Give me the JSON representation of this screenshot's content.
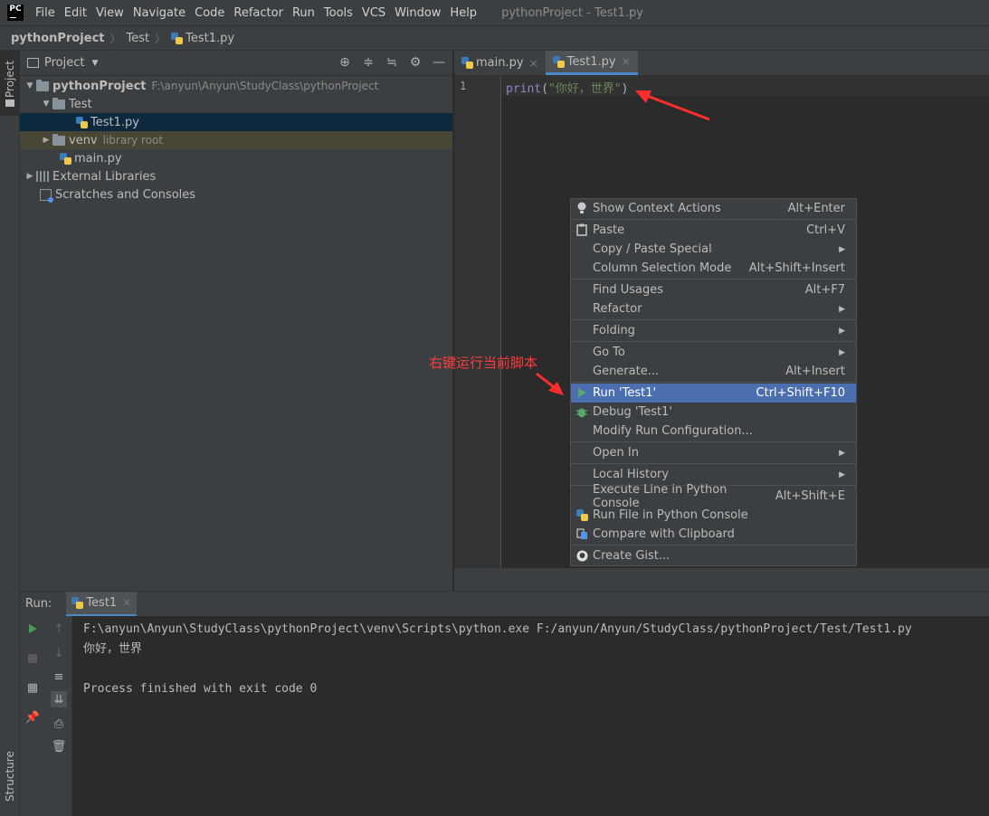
{
  "app": {
    "logo_text": "PC",
    "window_title": "pythonProject - Test1.py"
  },
  "menu": [
    "File",
    "Edit",
    "View",
    "Navigate",
    "Code",
    "Refactor",
    "Run",
    "Tools",
    "VCS",
    "Window",
    "Help"
  ],
  "breadcrumb": {
    "project": "pythonProject",
    "folder": "Test",
    "file": "Test1.py"
  },
  "left_strip": {
    "project_tab": "Project",
    "structure_tab": "Structure"
  },
  "project_panel": {
    "title": "Project",
    "tree": {
      "root_name": "pythonProject",
      "root_path": "F:\\anyun\\Anyun\\StudyClass\\pythonProject",
      "test_folder": "Test",
      "test_file": "Test1.py",
      "venv": "venv",
      "venv_note": "library root",
      "main_file": "main.py",
      "external_libs": "External Libraries",
      "scratches": "Scratches and Consoles"
    }
  },
  "editor": {
    "tabs": [
      {
        "label": "main.py",
        "active": false
      },
      {
        "label": "Test1.py",
        "active": true
      }
    ],
    "line_number": "1",
    "code": {
      "func": "print",
      "open": "(",
      "string": "\"你好，世界\"",
      "close": ")"
    }
  },
  "context_menu": {
    "items": [
      {
        "label": "Show Context Actions",
        "shortcut": "Alt+Enter",
        "icon": "bulb-icon"
      },
      {
        "label": "Paste",
        "shortcut": "Ctrl+V",
        "icon": "clipboard-icon"
      },
      {
        "label": "Copy / Paste Special",
        "submenu": true
      },
      {
        "label": "Column Selection Mode",
        "shortcut": "Alt+Shift+Insert"
      },
      {
        "label": "Find Usages",
        "shortcut": "Alt+F7"
      },
      {
        "label": "Refactor",
        "submenu": true
      },
      {
        "label": "Folding",
        "submenu": true
      },
      {
        "label": "Go To",
        "submenu": true
      },
      {
        "label": "Generate...",
        "shortcut": "Alt+Insert"
      },
      {
        "label": "Run 'Test1'",
        "shortcut": "Ctrl+Shift+F10",
        "icon": "run-icon",
        "highlighted": true
      },
      {
        "label": "Debug 'Test1'",
        "icon": "bug-icon"
      },
      {
        "label": "Modify Run Configuration..."
      },
      {
        "label": "Open In",
        "submenu": true
      },
      {
        "label": "Local History",
        "submenu": true
      },
      {
        "label": "Execute Line in Python Console",
        "shortcut": "Alt+Shift+E"
      },
      {
        "label": "Run File in Python Console",
        "icon": "python-icon"
      },
      {
        "label": "Compare with Clipboard",
        "icon": "compare-icon"
      },
      {
        "label": "Create Gist...",
        "icon": "github-icon"
      }
    ]
  },
  "annotation": {
    "text": "右键运行当前脚本",
    "color": "#ff3b3b"
  },
  "run_panel": {
    "label": "Run:",
    "tab": "Test1",
    "console_lines": [
      "F:\\anyun\\Anyun\\StudyClass\\pythonProject\\venv\\Scripts\\python.exe F:/anyun/Anyun/StudyClass/pythonProject/Test/Test1.py",
      "你好，世界",
      "",
      "Process finished with exit code 0"
    ]
  },
  "colors": {
    "accent": "#4b6eaf",
    "tab_underline": "#4a88c7",
    "run_green": "#499c54"
  }
}
